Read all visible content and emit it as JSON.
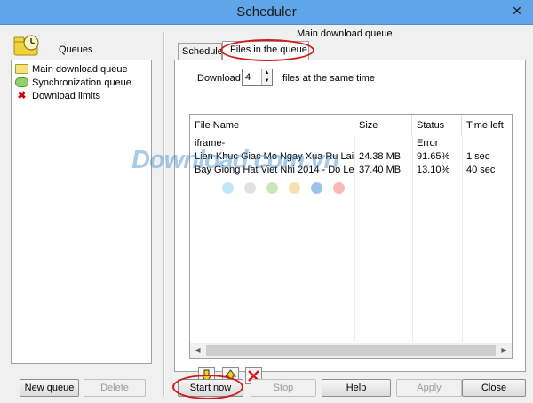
{
  "window": {
    "title": "Scheduler",
    "close_glyph": "✕"
  },
  "queues": {
    "title": "Queues",
    "items": [
      {
        "label": "Main download queue",
        "icon": "folder-icon"
      },
      {
        "label": "Synchronization queue",
        "icon": "sync-icon"
      },
      {
        "label": "Download limits",
        "icon": "limit-icon"
      }
    ],
    "new_queue_label": "New queue",
    "delete_label": "Delete"
  },
  "main": {
    "queue_title": "Main download queue",
    "tabs": [
      {
        "label": "Schedule",
        "active": false
      },
      {
        "label": "Files in the queue",
        "active": true
      }
    ],
    "download_label": "Download",
    "download_count": "4",
    "download_suffix": "files at the same time",
    "table": {
      "columns": [
        "File Name",
        "Size",
        "Status",
        "Time left"
      ],
      "rows": [
        [
          "iframe-",
          "",
          "Error",
          ""
        ],
        [
          "Lien Khuc Giac Mo Ngay Xua Ru Lai ...",
          "24.38  MB",
          "91.65%",
          "1 sec"
        ],
        [
          "Bay Giong Hat Viet Nhi 2014 - Do Le ...",
          "37.40  MB",
          "13.10%",
          "40 sec"
        ]
      ]
    }
  },
  "watermark": {
    "text": "Download.com.vn",
    "dot_colors": [
      "#8fcff0",
      "#c8c8c8",
      "#93d67a",
      "#f6c66c",
      "#4a90d9",
      "#f07f7f"
    ]
  },
  "buttons": {
    "start": "Start now",
    "stop": "Stop",
    "help": "Help",
    "apply": "Apply",
    "close": "Close"
  },
  "colors": {
    "titlebar": "#5ea6e8",
    "highlight_ring": "#d11a1a"
  }
}
